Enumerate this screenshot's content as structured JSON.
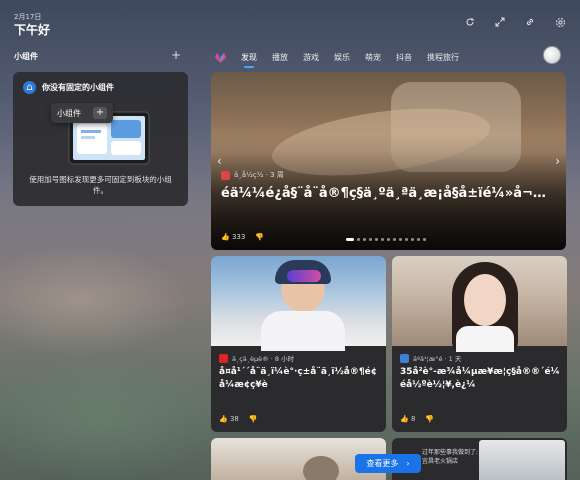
{
  "header": {
    "date": "2月17日",
    "greeting": "下午好",
    "actions": [
      "refresh-icon",
      "expand-icon",
      "link-icon",
      "settings-icon"
    ]
  },
  "widgets": {
    "title": "小组件",
    "add_label": "+",
    "card_title": "你没有固定的小组件",
    "tooltip_label": "小组件",
    "tooltip_add": "+",
    "description": "使用加号图标发现更多可固定到板块的小组件。"
  },
  "nav": {
    "tabs": [
      "发现",
      "播放",
      "游戏",
      "娱乐",
      "萌宠",
      "抖音",
      "携程旅行"
    ],
    "active_index": 0
  },
  "hero": {
    "source": "ä¸­å½ç½ · 3 周",
    "title": "é­ä¼¼é¿å§¨å¨å®¶ç§ä¸ºä¸ªä¸æ¡å§å±ïé¼»å¬…",
    "likes": "333",
    "slide_count": 13,
    "active_slide": 0
  },
  "cards": [
    {
      "source": "ä¸çä¸èµè® · 8 小时",
      "title": "å¤å¹´´å¨ä¸ï¼è°·ç±å¨ä¸ï½å®¶é¢å¼æ¢ç¥è",
      "likes": "38"
    },
    {
      "source": "äºä¹¦æ°é · 1 天",
      "title": "35å²è°-æ¾å¼µæ¥æ¦ç§å®®´é¼éå½ºè½¦¥,è¿¼",
      "likes": "8"
    }
  ],
  "bottom": {
    "card2_text_line1": "过年那些事我做到了: 一座食",
    "card2_text_line2": "宜昌老火锅店"
  },
  "see_more": {
    "label": "查看更多",
    "chevron": "›"
  },
  "colors": {
    "accent": "#1a73e8",
    "tab_indicator": "#4aa3ff",
    "card_bg": "#2b2b2e"
  }
}
